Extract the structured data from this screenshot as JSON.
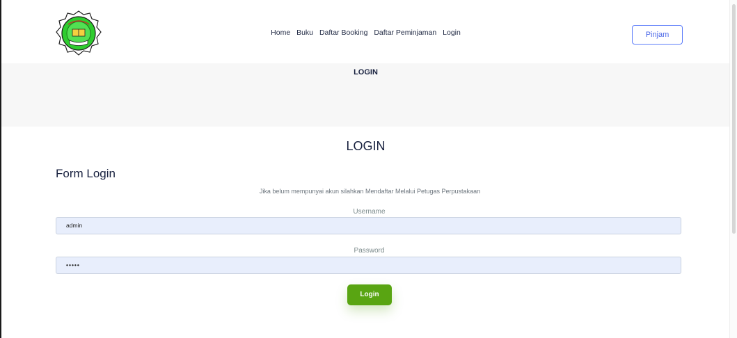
{
  "header": {
    "logo_icon": "school-emblem-icon",
    "nav": [
      "Home",
      "Buku",
      "Daftar Booking",
      "Daftar Peminjaman",
      "Login"
    ],
    "pinjam_label": "Pinjam"
  },
  "banner": {
    "title": "LOGIN"
  },
  "main": {
    "heading": "LOGIN",
    "form_title": "Form Login",
    "info": "Jika belum mempunyai akun silahkan Mendaftar Melalui Petugas Perpustakaan",
    "username_label": "Username",
    "username_value": "admin",
    "password_label": "Password",
    "password_value": "•••••",
    "login_label": "Login"
  },
  "colors": {
    "accent_green": "#59a512",
    "accent_blue": "#4a67e8",
    "input_bg": "#e8eefc",
    "banner_bg": "#f7f7f7"
  }
}
